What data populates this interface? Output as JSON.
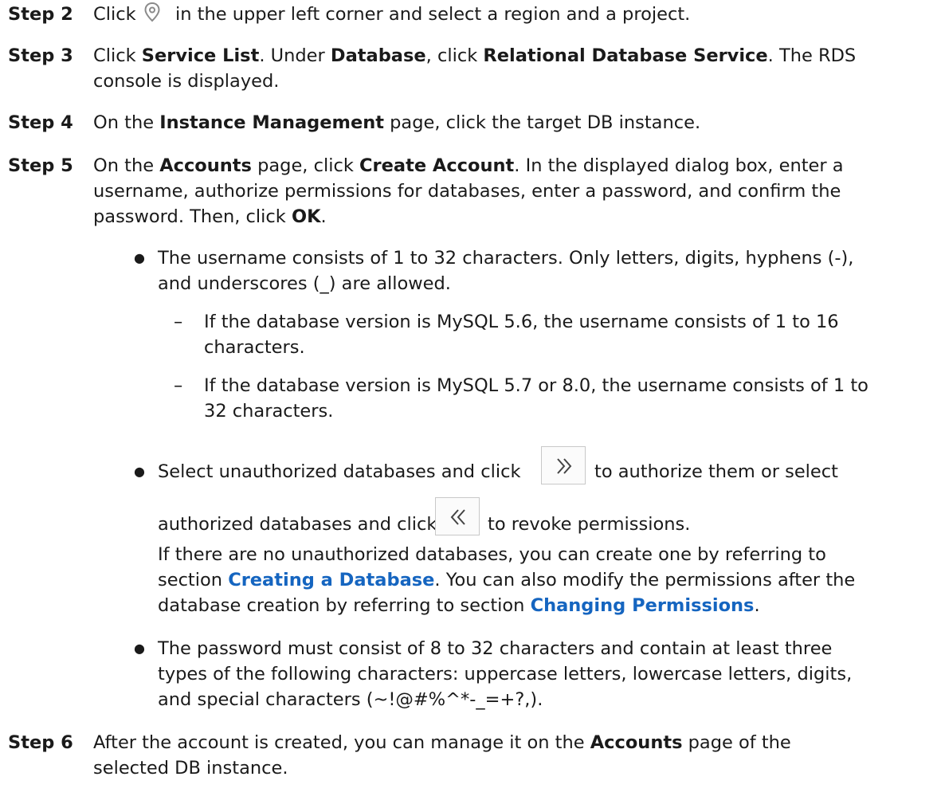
{
  "steps": {
    "s2": {
      "label": "Step 2",
      "t1": "Click",
      "t2": "in the upper left corner and select a region and a project."
    },
    "s3": {
      "label": "Step 3",
      "t1": "Click ",
      "b1": "Service List",
      "t2": ". Under ",
      "b2": "Database",
      "t3": ", click ",
      "b3": "Relational Database Service",
      "t4": ". The RDS",
      "l2": "console is displayed."
    },
    "s4": {
      "label": "Step 4",
      "t1": "On the ",
      "b1": "Instance Management",
      "t2": " page, click the target DB instance."
    },
    "s5": {
      "label": "Step 5",
      "t1": "On the ",
      "b1": "Accounts",
      "t2": " page, click ",
      "b2": "Create Account",
      "t3": ". In the displayed dialog box, enter a",
      "l2": "username, authorize permissions for databases, enter a password, and confirm the",
      "l3a": "password. Then, click ",
      "l3b": "OK",
      "l3c": "."
    },
    "s6": {
      "label": "Step 6",
      "t1": "After the account is created, you can manage it on the ",
      "b1": "Accounts",
      "t2": " page of the",
      "l2": "selected DB instance."
    }
  },
  "bullets": {
    "b1": {
      "l1": "The username consists of 1 to 32 characters. Only letters, digits, hyphens (-),",
      "l2": "and underscores (_) are allowed."
    },
    "sub1": {
      "l1": "If the database version is MySQL 5.6, the username consists of 1 to 16",
      "l2": "characters."
    },
    "sub2": {
      "l1": "If the database version is MySQL 5.7 or 8.0, the username consists of 1 to",
      "l2": "32 characters."
    },
    "b2": {
      "l1a": "Select unauthorized databases and click",
      "l1b": "to authorize them or select",
      "l2a": "authorized databases and click",
      "l2b": "to revoke permissions.",
      "p1": "If there are no unauthorized databases, you can create one by referring to",
      "p2a": "section ",
      "p2link": "Creating a Database",
      "p2b": ". You can also modify the permissions after the",
      "p3a": "database creation by referring to section ",
      "p3link": "Changing Permissions",
      "p3b": "."
    },
    "b3": {
      "l1": "The password must consist of 8 to 32 characters and contain at least three",
      "l2": "types of the following characters: uppercase letters, lowercase letters, digits,",
      "l3": "and special characters (~!@#%^*-_=+?,)."
    }
  },
  "symbols": {
    "bullet": "●",
    "dash": "–"
  },
  "icons": {
    "location": "location-pin-icon",
    "authorize": "double-chevron-right-icon",
    "revoke": "double-chevron-left-icon"
  }
}
